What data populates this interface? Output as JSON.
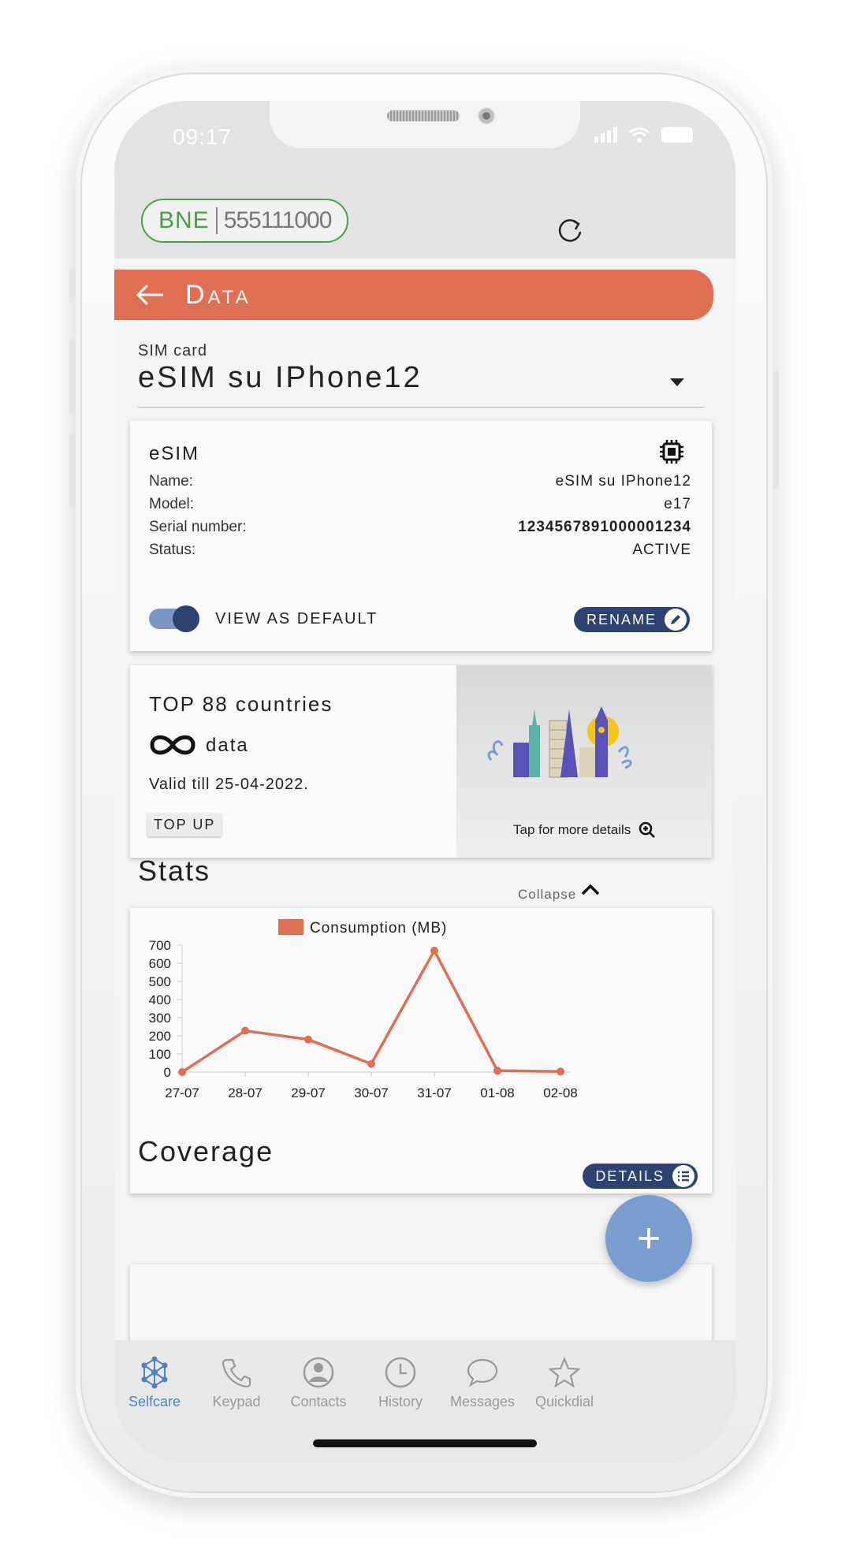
{
  "status_bar": {
    "time": "09:17"
  },
  "top_bar": {
    "operator_code": "BNE",
    "phone_number": "555111000"
  },
  "header": {
    "title": "Data"
  },
  "sim_card": {
    "label": "SIM card",
    "selected": "eSIM su IPhone12"
  },
  "esim_card": {
    "title": "eSIM",
    "fields": [
      {
        "key": "Name:",
        "value": "eSIM su IPhone12"
      },
      {
        "key": "Model:",
        "value": "e17"
      },
      {
        "key": "Serial number:",
        "value": "1234567891000001234"
      },
      {
        "key": "Status:",
        "value": "ACTIVE"
      }
    ],
    "toggle_label": "VIEW AS DEFAULT",
    "toggle_on": true,
    "rename_label": "RENAME"
  },
  "plan": {
    "title": "TOP 88 countries",
    "data_label": "data",
    "valid": "Valid till 25-04-2022.",
    "topup_label": "TOP UP",
    "tap_details": "Tap for more details"
  },
  "stats": {
    "title": "Stats",
    "collapse_label": "Collapse",
    "details_label": "DETAILS"
  },
  "chart_data": {
    "type": "line",
    "categories": [
      "27-07",
      "28-07",
      "29-07",
      "30-07",
      "31-07",
      "01-08",
      "02-08"
    ],
    "series": [
      {
        "name": "Consumption (MB)",
        "values": [
          0,
          228,
          180,
          45,
          670,
          8,
          3
        ]
      }
    ],
    "ylim": [
      0,
      700
    ],
    "yticks": [
      "0",
      "100",
      "200",
      "300",
      "400",
      "500",
      "600",
      "700"
    ],
    "legend": "top-center",
    "color": "#e06e52"
  },
  "coverage": {
    "title": "Coverage"
  },
  "fab": {
    "label": "+"
  },
  "tabs": [
    {
      "label": "Selfcare",
      "icon": "network-icon",
      "active": true
    },
    {
      "label": "Keypad",
      "icon": "phone-icon",
      "active": false
    },
    {
      "label": "Contacts",
      "icon": "contact-icon",
      "active": false
    },
    {
      "label": "History",
      "icon": "clock-icon",
      "active": false
    },
    {
      "label": "Messages",
      "icon": "chat-icon",
      "active": false
    },
    {
      "label": "Quickdial",
      "icon": "star-icon",
      "active": false
    }
  ],
  "colors": {
    "accent": "#e06e52",
    "primary": "#2c4372",
    "operator": "#4aa04a",
    "active_tab": "#4d82c4"
  }
}
